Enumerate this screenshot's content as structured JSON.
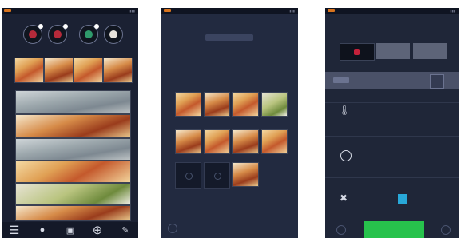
{
  "screens": {
    "menu": {
      "categories": [
        {
          "label": "",
          "icon": "chicken-icon"
        },
        {
          "label": "",
          "icon": "meat-icon"
        },
        {
          "label": "",
          "icon": "fish-icon"
        },
        {
          "label": "",
          "icon": "bakery-icon"
        }
      ],
      "banners": [
        "",
        "",
        "",
        "",
        ""
      ],
      "tabbar": [
        {
          "icon": "menu-icon"
        },
        {
          "icon": "fire-icon"
        },
        {
          "icon": "trash-icon"
        },
        {
          "icon": "add-circle-icon"
        },
        {
          "icon": "edit-icon"
        }
      ]
    },
    "recipes": {
      "title": "",
      "tiles": [
        "",
        "",
        "",
        "",
        "",
        "",
        "",
        "",
        ""
      ]
    },
    "cooking": {
      "title": "",
      "mode_tabs": [
        "",
        "",
        ""
      ],
      "sub_tabs": [
        "",
        ""
      ],
      "temperature": "",
      "time": "",
      "fan_level": "",
      "humidity": "",
      "start_label": ""
    }
  },
  "colors": {
    "background": "#1b2133",
    "accent_red": "#c4213a",
    "start_green": "#27c24c",
    "brand_orange": "#d9741e"
  }
}
